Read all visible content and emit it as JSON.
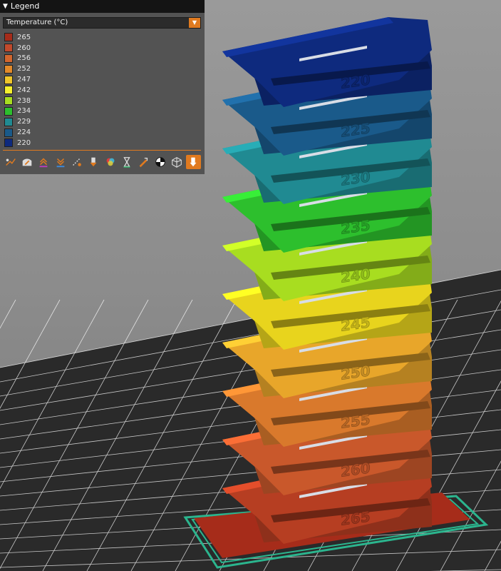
{
  "legend": {
    "title": "Legend",
    "view_type": "Temperature (°C)",
    "items": [
      {
        "label": "265",
        "color": "#a62c1a"
      },
      {
        "label": "260",
        "color": "#c14a2c"
      },
      {
        "label": "256",
        "color": "#d2662e"
      },
      {
        "label": "252",
        "color": "#e38a2a"
      },
      {
        "label": "247",
        "color": "#efc62b"
      },
      {
        "label": "242",
        "color": "#f5f02e"
      },
      {
        "label": "238",
        "color": "#a8dd20"
      },
      {
        "label": "234",
        "color": "#2dbf2d"
      },
      {
        "label": "229",
        "color": "#208a92"
      },
      {
        "label": "224",
        "color": "#1a5a8a"
      },
      {
        "label": "220",
        "color": "#0e2a7e"
      }
    ]
  },
  "toolbar": {
    "buttons": [
      {
        "icon": "travel-icon",
        "active": false
      },
      {
        "icon": "wipe-icon",
        "active": false
      },
      {
        "icon": "retractions-icon",
        "active": false
      },
      {
        "icon": "deretractions-icon",
        "active": false
      },
      {
        "icon": "seams-icon",
        "active": false
      },
      {
        "icon": "tool-changes-icon",
        "active": false
      },
      {
        "icon": "color-changes-icon",
        "active": false
      },
      {
        "icon": "pause-icon",
        "active": false
      },
      {
        "icon": "custom-gcode-icon",
        "active": false
      },
      {
        "icon": "center-of-gravity-icon",
        "active": false
      },
      {
        "icon": "shells-icon",
        "active": false
      },
      {
        "icon": "tool-marker-icon",
        "active": true
      }
    ]
  },
  "model": {
    "tier_labels": [
      "220",
      "225",
      "230",
      "235",
      "240",
      "245",
      "250",
      "255",
      "260",
      "265"
    ],
    "tier_colors": [
      "#0e2a7e",
      "#1a5a8a",
      "#208a92",
      "#2dbf2d",
      "#a8dd20",
      "#e8d41d",
      "#e8a62a",
      "#d9792c",
      "#c9582b",
      "#b63e22"
    ],
    "base_color": "#a62c1a",
    "outline_color": "#2bb58e"
  },
  "colors": {
    "accent": "#e07a1f",
    "bed_line": "#ffffff",
    "bed": "#2a2a2a"
  }
}
